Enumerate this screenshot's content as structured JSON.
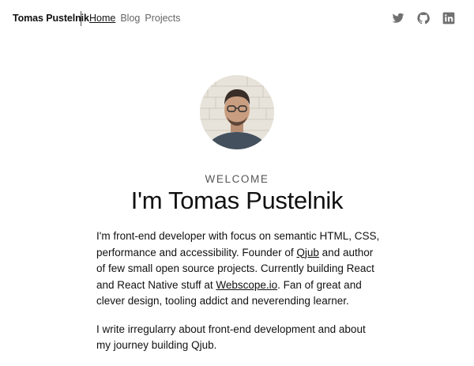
{
  "header": {
    "brand": "Tomas Pustelnik",
    "nav": [
      {
        "label": "Home",
        "active": true
      },
      {
        "label": "Blog",
        "active": false
      },
      {
        "label": "Projects",
        "active": false
      }
    ],
    "social": [
      "twitter-icon",
      "github-icon",
      "linkedin-icon"
    ]
  },
  "hero": {
    "welcome": "WELCOME",
    "title": "I'm Tomas Pustelnik"
  },
  "intro": {
    "p1_a": "I'm front-end developer with focus on semantic HTML, CSS, performance and accessibility. Founder of ",
    "p1_link1": "Qjub",
    "p1_b": " and author of few small open source projects. Currently building React and React Native stuff at ",
    "p1_link2": "Webscope.io",
    "p1_c": ". Fan of great and clever design, tooling addict and neverending learner.",
    "p2": "I write irregularry about front-end development and about my journey building Qjub."
  },
  "colors": {
    "text": "#111111",
    "muted": "#666666",
    "icon": "#707070"
  }
}
